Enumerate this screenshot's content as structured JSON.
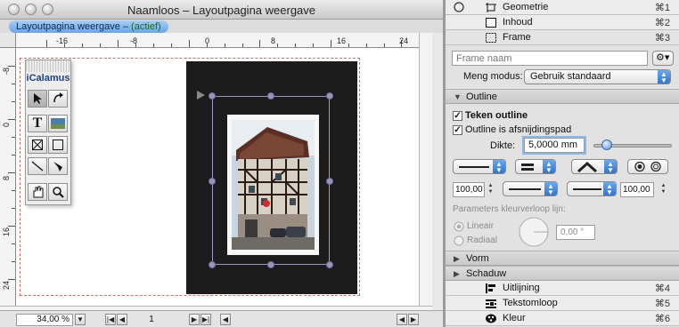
{
  "window": {
    "title": "Naamloos – Layoutpagina weergave",
    "tab_label": "Layoutpagina weergave – ",
    "tab_status": "(actief)"
  },
  "ruler": {
    "horizontal_labels": [
      "-16",
      "-8",
      "0",
      "8",
      "16",
      "24"
    ],
    "vertical_labels": [
      "-8",
      "0",
      "8",
      "16",
      "24"
    ]
  },
  "toolbox": {
    "title": "iCalamus",
    "tools": [
      "arrow-tool",
      "rotate-tool",
      "text-tool",
      "image-tool",
      "frame-x-tool",
      "rectangle-tool",
      "line-tool",
      "bezier-tool",
      "hand-tool",
      "zoom-tool"
    ]
  },
  "status": {
    "zoom": "34,00 %",
    "page_number": "1"
  },
  "palette": {
    "top_rows": [
      {
        "label": "Geometrie",
        "shortcut": "⌘1"
      },
      {
        "label": "Inhoud",
        "shortcut": "⌘2"
      },
      {
        "label": "Frame",
        "shortcut": "⌘3"
      }
    ],
    "frame_name_placeholder": "Frame naam",
    "blend_mode_label": "Meng modus:",
    "blend_mode_value": "Gebruik standaard",
    "outline_section": "Outline",
    "draw_outline_label": "Teken outline",
    "clip_path_label": "Outline is afsnijdingspad",
    "thickness_label": "Dikte:",
    "thickness_value": "5,0000 mm",
    "percent_left": "100,00",
    "percent_right": "100,00",
    "gradient_params_label": "Parameters kleurverloop lijn:",
    "radio_linear": "Lineair",
    "radio_radial": "Radiaal",
    "angle_value": "0,00 °",
    "shape_section": "Vorm",
    "shadow_section": "Schaduw",
    "bottom_rows": [
      {
        "label": "Uitlijning",
        "shortcut": "⌘4"
      },
      {
        "label": "Tekstomloop",
        "shortcut": "⌘5"
      },
      {
        "label": "Kleur",
        "shortcut": "⌘6"
      }
    ]
  },
  "colors": {
    "accent": "#2f74d0",
    "frame_handle": "#9794bf",
    "page_border": "#c87070"
  }
}
